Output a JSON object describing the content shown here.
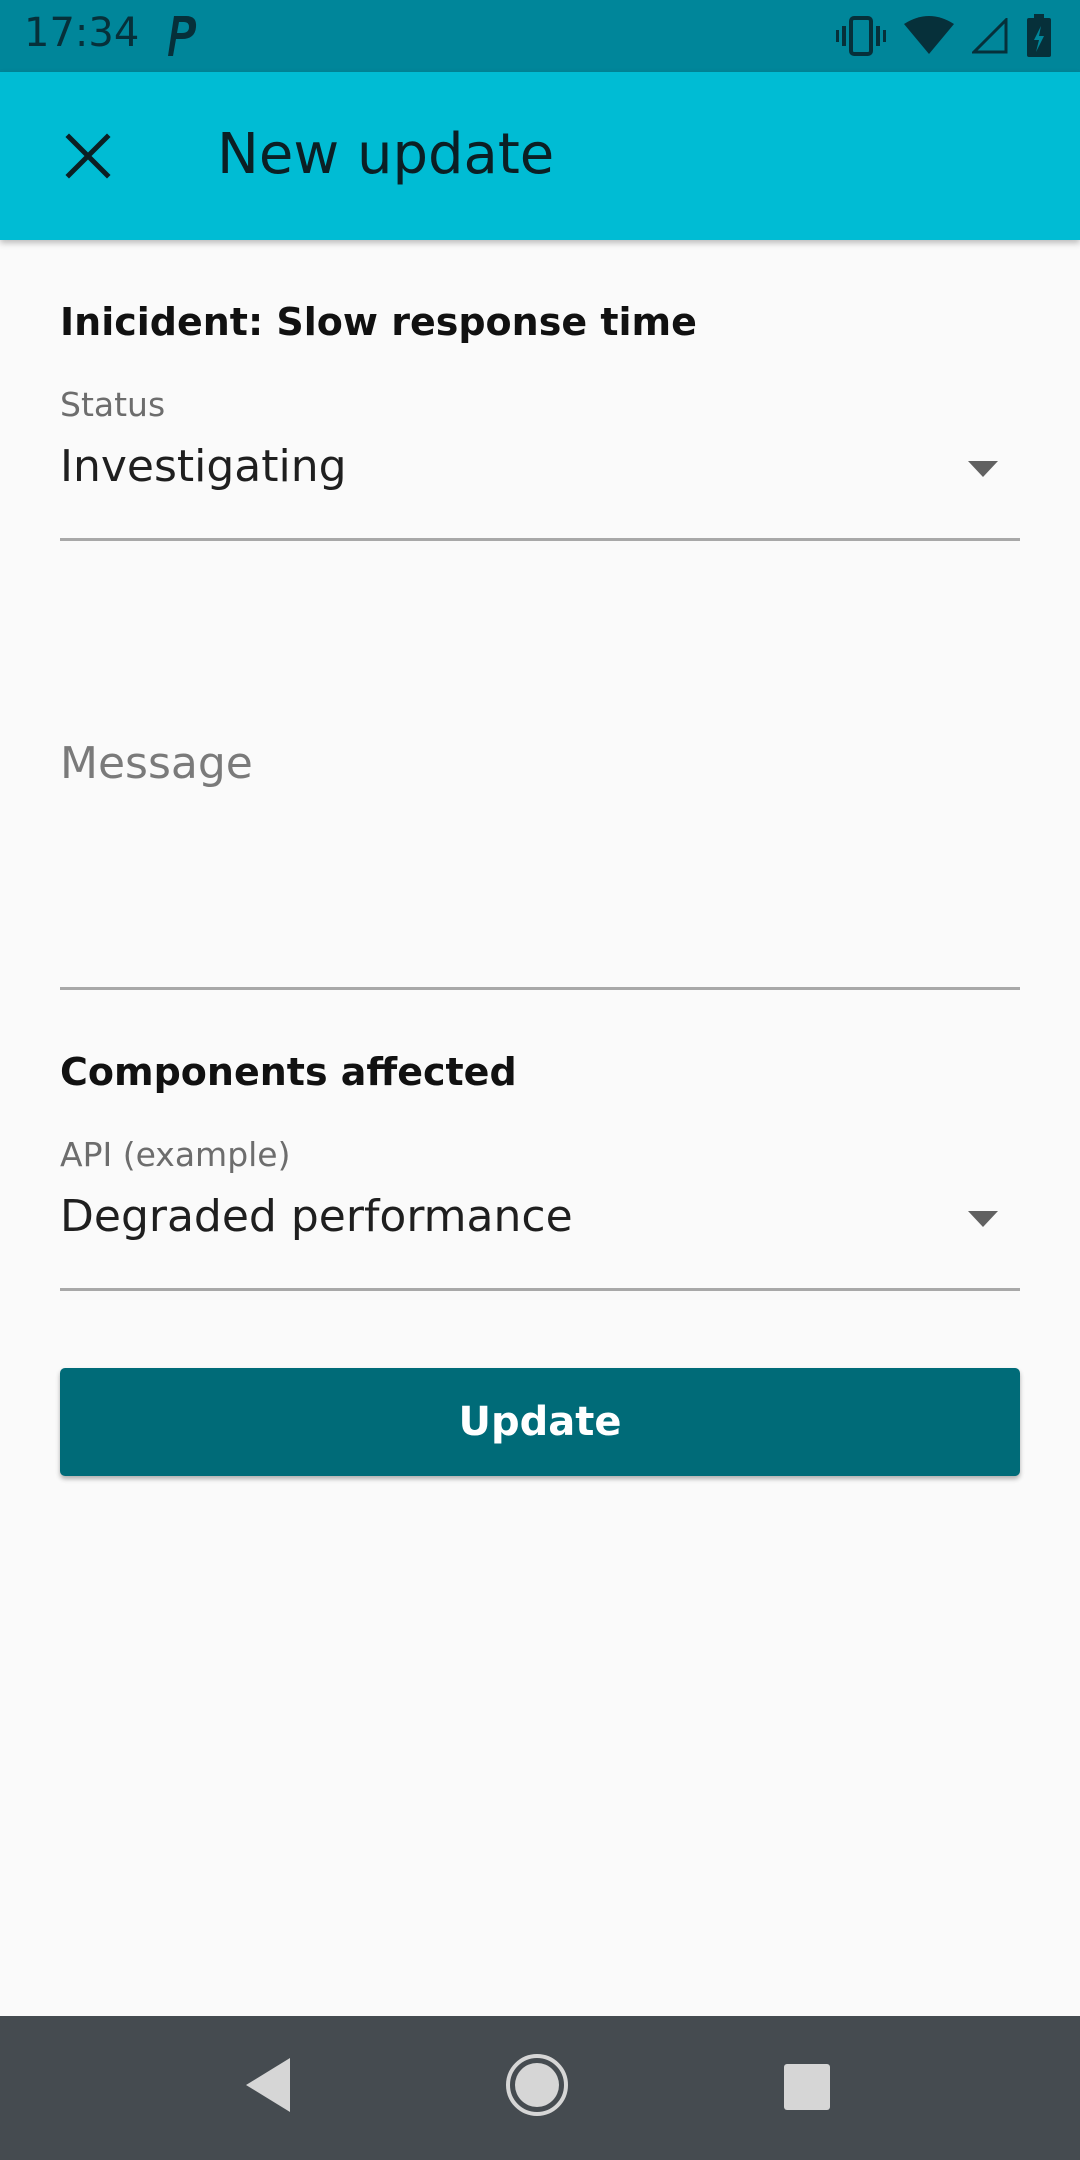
{
  "status_bar": {
    "time": "17:34",
    "icons": [
      "parking-notification-icon",
      "vibrate-icon",
      "wifi-icon",
      "signal-icon",
      "battery-charging-icon"
    ]
  },
  "app_bar": {
    "title": "New update",
    "close_icon": "close-icon"
  },
  "form": {
    "incident_title": "Inicident: Slow response time",
    "status": {
      "label": "Status",
      "value": "Investigating"
    },
    "message": {
      "placeholder": "Message",
      "value": ""
    },
    "components_section_title": "Components affected",
    "component": {
      "label": "API (example)",
      "value": "Degraded performance"
    },
    "submit_label": "Update"
  },
  "nav_bar": {
    "icons": [
      "back-icon",
      "home-icon",
      "recents-icon"
    ]
  },
  "colors": {
    "status_bar": "#00869a",
    "app_bar": "#00bcd4",
    "button": "#006b78",
    "background": "#fafafa",
    "nav_bar": "#454b50"
  }
}
